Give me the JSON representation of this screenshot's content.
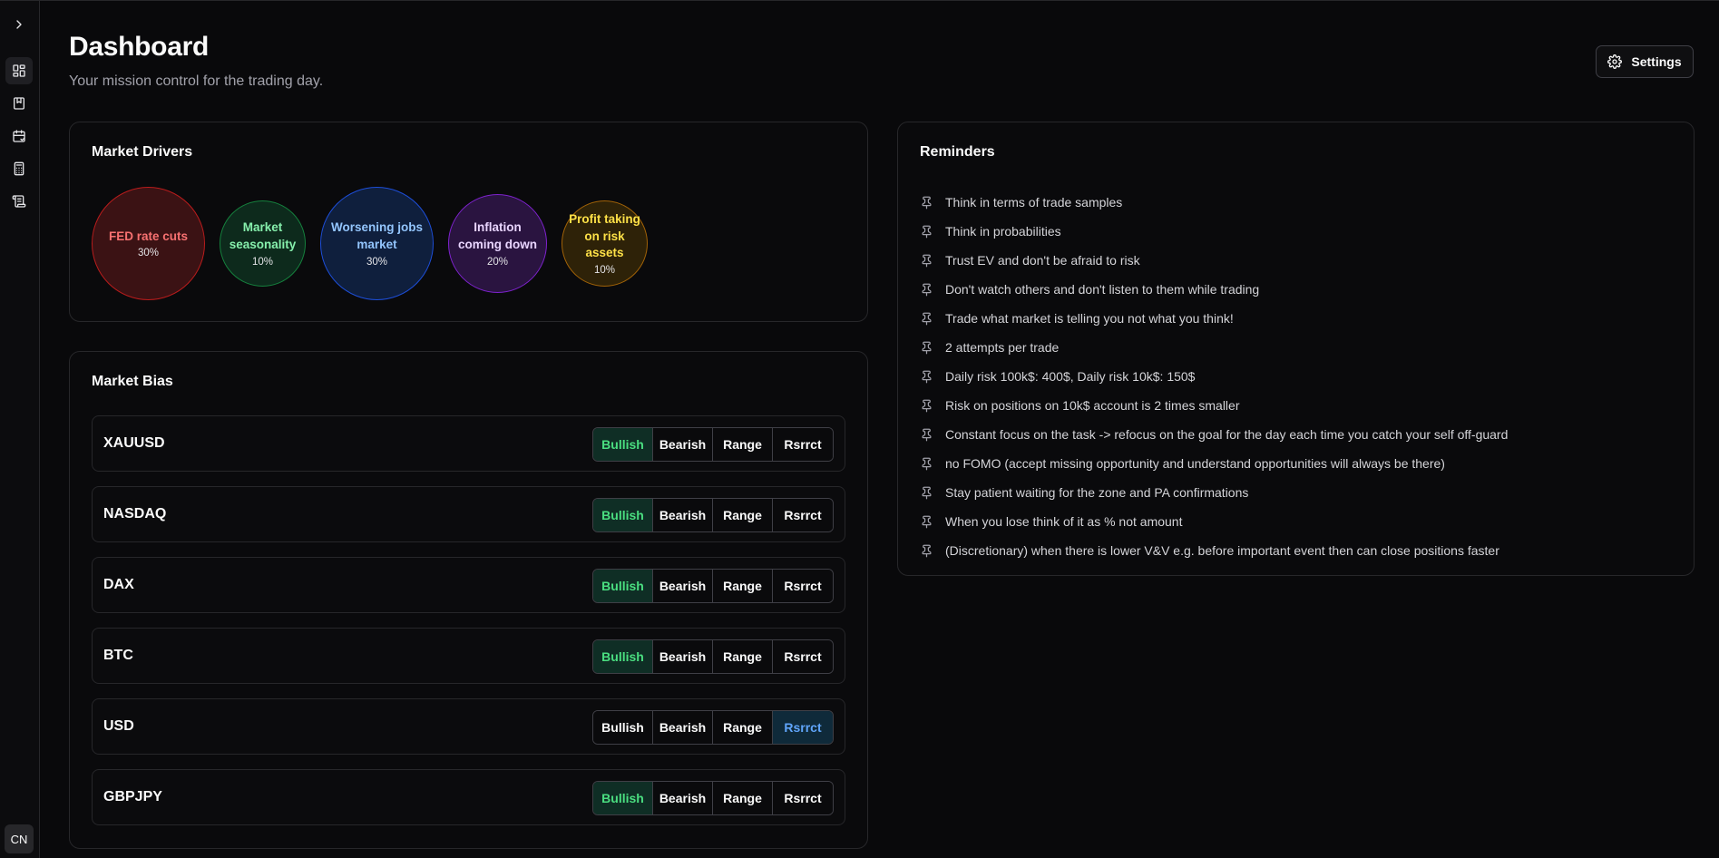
{
  "page": {
    "title": "Dashboard",
    "subtitle": "Your mission control for the trading day.",
    "settings_label": "Settings"
  },
  "sidebar": {
    "items": [
      {
        "icon": "chevron-right-icon"
      },
      {
        "icon": "dashboard-icon"
      },
      {
        "icon": "notebook-icon"
      },
      {
        "icon": "calendar-icon"
      },
      {
        "icon": "calculator-icon"
      },
      {
        "icon": "scroll-icon"
      }
    ],
    "avatar": "CN"
  },
  "drivers": {
    "title": "Market Drivers",
    "items": [
      {
        "label": "FED rate cuts",
        "pct": "30%",
        "color": "#f87171",
        "bg": "#3b1214",
        "border": "#b91c1c"
      },
      {
        "label": "Market seasonality",
        "pct": "10%",
        "color": "#86efac",
        "bg": "#0d2a1c",
        "border": "#15803d"
      },
      {
        "label": "Worsening jobs market",
        "pct": "30%",
        "color": "#93c5fd",
        "bg": "#0f1f3d",
        "border": "#1d4ed8"
      },
      {
        "label": "Inflation coming down",
        "pct": "20%",
        "color": "#e9d5ff",
        "bg": "#2a1440",
        "border": "#7e22ce"
      },
      {
        "label": "Profit taking on risk assets",
        "pct": "10%",
        "color": "#fde047",
        "bg": "#2e2208",
        "border": "#a16207"
      }
    ]
  },
  "bias": {
    "title": "Market Bias",
    "options": [
      "Bullish",
      "Bearish",
      "Range",
      "Rsrrct"
    ],
    "rows": [
      {
        "name": "XAUUSD",
        "selected": "Bullish"
      },
      {
        "name": "NASDAQ",
        "selected": "Bullish"
      },
      {
        "name": "DAX",
        "selected": "Bullish"
      },
      {
        "name": "BTC",
        "selected": "Bullish"
      },
      {
        "name": "USD",
        "selected": "Rsrrct"
      },
      {
        "name": "GBPJPY",
        "selected": "Bullish"
      }
    ]
  },
  "reminders": {
    "title": "Reminders",
    "items": [
      "Think in terms of trade samples",
      "Think in probabilities",
      "Trust EV and don't be afraid to risk",
      "Don't watch others and don't listen to them while trading",
      "Trade what market is telling you not what you think!",
      "2 attempts per trade",
      "Daily risk 100k$: 400$, Daily risk 10k$: 150$",
      "Risk on positions on 10k$ account is 2 times smaller",
      "Constant focus on the task -> refocus on the goal for the day each time you catch your self off-guard",
      "no FOMO (accept missing opportunity and understand opportunities will always be there)",
      "Stay patient waiting for the zone and PA confirmations",
      "When you lose think of it as % not amount",
      "(Discretionary) when there is lower V&V e.g. before important event then can close positions faster"
    ]
  }
}
